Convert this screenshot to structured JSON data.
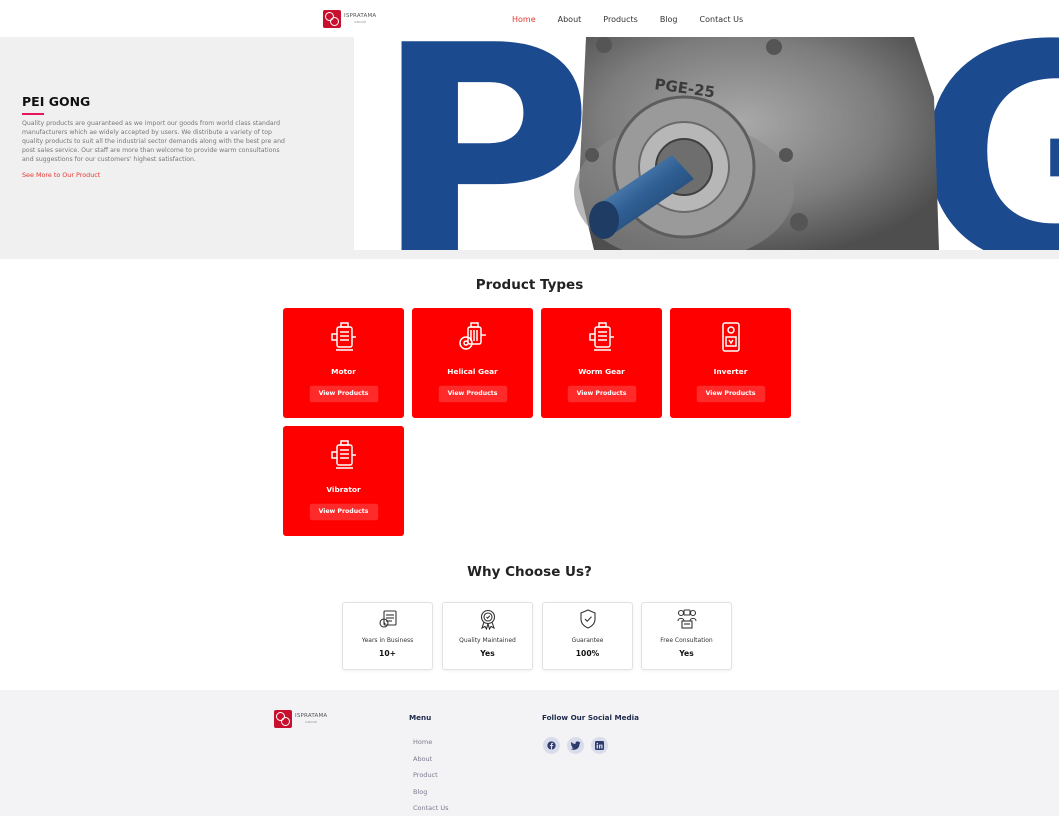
{
  "header": {
    "logo_text": "ISPRATAMA",
    "logo_sub": "GROUP",
    "nav": [
      {
        "label": "Home",
        "active": true
      },
      {
        "label": "About"
      },
      {
        "label": "Products"
      },
      {
        "label": "Blog"
      },
      {
        "label": "Contact Us"
      }
    ]
  },
  "hero": {
    "title": "PEI GONG",
    "description": "Quality products are guaranteed as we import our goods from world class standard manufacturers which ae widely accepted by users. We distribute a variety of top quality products to suit all the industrial sector demands along with the best pre and post sales service. Our staff are more than welcome to provide warm consultations and suggestions for our customers' highest satisfaction.",
    "link": "See More to Our Product",
    "image_text": "PGE-25",
    "bg_letters": [
      "P",
      "G"
    ]
  },
  "product_types": {
    "title": "Product Types",
    "items": [
      {
        "name": "Motor",
        "button": "View Products",
        "icon": "motor-icon"
      },
      {
        "name": "Helical Gear",
        "button": "View Products",
        "icon": "helical-gear-icon"
      },
      {
        "name": "Worm Gear",
        "button": "View Products",
        "icon": "worm-gear-icon"
      },
      {
        "name": "Inverter",
        "button": "View Products",
        "icon": "inverter-icon"
      },
      {
        "name": "Vibrator",
        "button": "View Products",
        "icon": "vibrator-icon"
      }
    ]
  },
  "why": {
    "title": "Why Choose Us?",
    "items": [
      {
        "label": "Years in Business",
        "value": "10+",
        "icon": "calendar-icon"
      },
      {
        "label": "Quality Maintained",
        "value": "Yes",
        "icon": "award-icon"
      },
      {
        "label": "Guarantee",
        "value": "100%",
        "icon": "shield-icon"
      },
      {
        "label": "Free Consultation",
        "value": "Yes",
        "icon": "consultation-icon"
      }
    ]
  },
  "footer": {
    "logo_text": "ISPRATAMA",
    "logo_sub": "GROUP",
    "menu_title": "Menu",
    "menu": [
      "Home",
      "About",
      "Product",
      "Blog",
      "Contact Us"
    ],
    "social_title": "Follow Our Social Media",
    "social": [
      "facebook-icon",
      "twitter-icon",
      "linkedin-icon"
    ]
  },
  "colors": {
    "accent_red": "#ff0000",
    "nav_active": "#e53935",
    "hero_blue": "#1c4a8f",
    "footer_bg": "#f3f3f5"
  }
}
